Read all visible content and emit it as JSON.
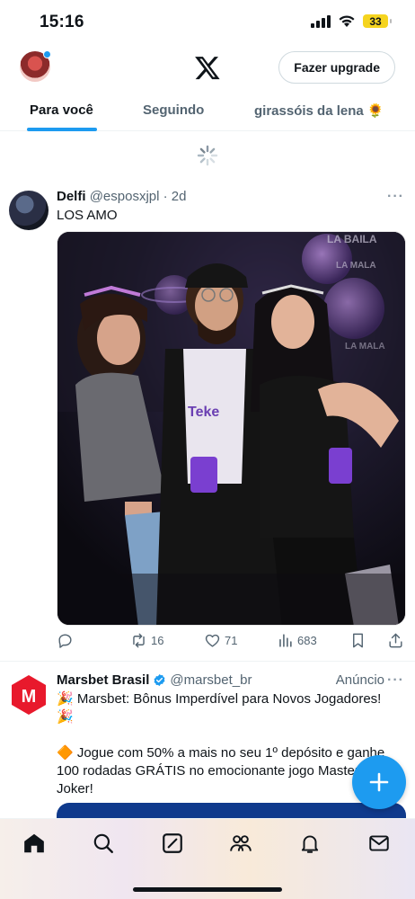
{
  "status_bar": {
    "time": "15:16",
    "battery": "33"
  },
  "header": {
    "upgrade_label": "Fazer upgrade"
  },
  "tabs": [
    {
      "label": "Para você",
      "active": true
    },
    {
      "label": "Seguindo",
      "active": false
    },
    {
      "label": "girassóis da lena 🌻",
      "active": false
    }
  ],
  "tweet": {
    "name": "Delfi",
    "handle": "@esposxjpl",
    "time": "· 2d",
    "text": "LOS AMO",
    "replies": "",
    "retweets": "16",
    "likes": "71",
    "views": "683"
  },
  "ad": {
    "name": "Marsbet Brasil",
    "handle": "@marsbet_br",
    "label": "Anúncio",
    "line1": "🎉 Marsbet: Bônus Imperdível para Novos Jogadores! 🎉",
    "line2": "🔶 Jogue com 50% a mais no seu 1º depósito e ganhe 100 rodadas GRÁTIS no emocionante jogo Master Joker!",
    "logo_letter": "M"
  },
  "colors": {
    "accent": "#1d9bf0",
    "ad_brand": "#e8192c",
    "text": "#0f1419",
    "muted": "#536471"
  },
  "icons": [
    "x-logo-icon",
    "spinner-icon",
    "reply-icon",
    "retweet-icon",
    "like-icon",
    "views-icon",
    "bookmark-icon",
    "share-icon",
    "verified-icon",
    "compose-plus-icon",
    "home-icon",
    "search-icon",
    "grok-icon",
    "communities-icon",
    "notifications-icon",
    "messages-icon"
  ]
}
